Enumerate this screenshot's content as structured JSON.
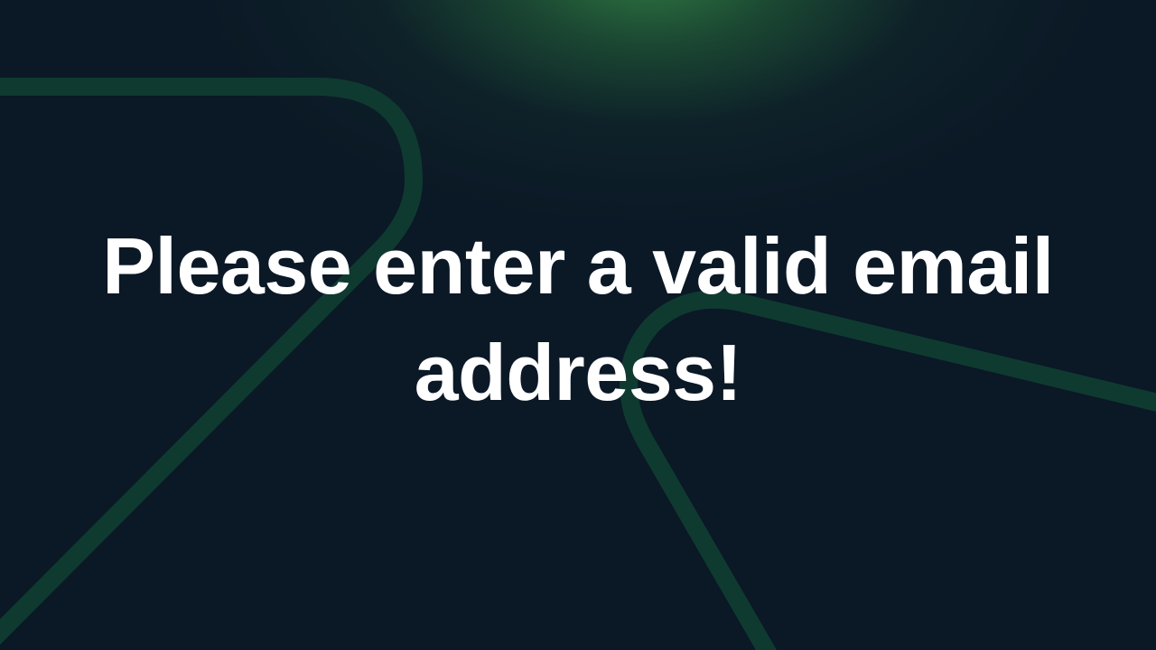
{
  "validation": {
    "message": "Please enter a valid email address!"
  },
  "colors": {
    "background": "#0b1826",
    "glow": "#2f7a45",
    "line_stroke": "#0f3a30",
    "text": "#ffffff"
  }
}
